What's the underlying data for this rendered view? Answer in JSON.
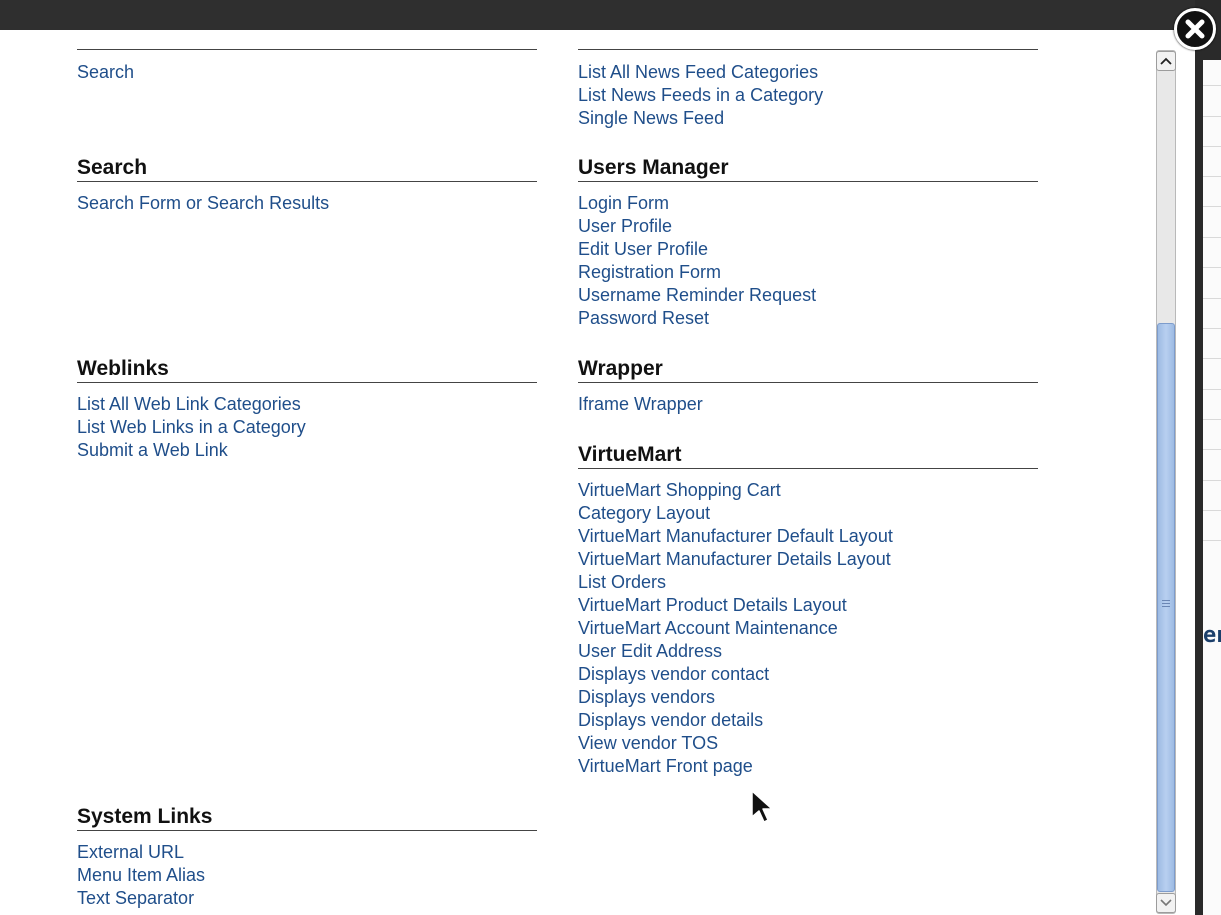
{
  "left_column": {
    "top_links": [
      "Search"
    ],
    "sections": [
      {
        "title": "Search",
        "links": [
          "Search Form or Search Results"
        ]
      },
      {
        "title": "Weblinks",
        "links": [
          "List All Web Link Categories",
          "List Web Links in a Category",
          "Submit a Web Link"
        ]
      },
      {
        "title": "System Links",
        "links": [
          "External URL",
          "Menu Item Alias",
          "Text Separator"
        ]
      }
    ]
  },
  "right_column": {
    "top_links": [
      "List All News Feed Categories",
      "List News Feeds in a Category",
      "Single News Feed"
    ],
    "sections": [
      {
        "title": "Users Manager",
        "links": [
          "Login Form",
          "User Profile",
          "Edit User Profile",
          "Registration Form",
          "Username Reminder Request",
          "Password Reset"
        ]
      },
      {
        "title": "Wrapper",
        "links": [
          "Iframe Wrapper"
        ]
      },
      {
        "title": "VirtueMart",
        "links": [
          "VirtueMart Shopping Cart",
          "Category Layout",
          "VirtueMart Manufacturer Default Layout",
          "VirtueMart Manufacturer Details Layout",
          "List Orders",
          "VirtueMart Product Details Layout",
          "VirtueMart Account Maintenance",
          "User Edit Address",
          "Displays vendor contact",
          "Displays vendors",
          "Displays vendor details",
          "View vendor TOS",
          "VirtueMart Front page"
        ]
      }
    ]
  },
  "background_peek_text": "en",
  "colors": {
    "link": "#1f4e8a",
    "heading": "#111111",
    "thumb": "#a9c4ea"
  },
  "icons": {
    "close": "close-icon",
    "scroll_up": "chevron-up-icon",
    "scroll_down": "chevron-down-icon"
  }
}
